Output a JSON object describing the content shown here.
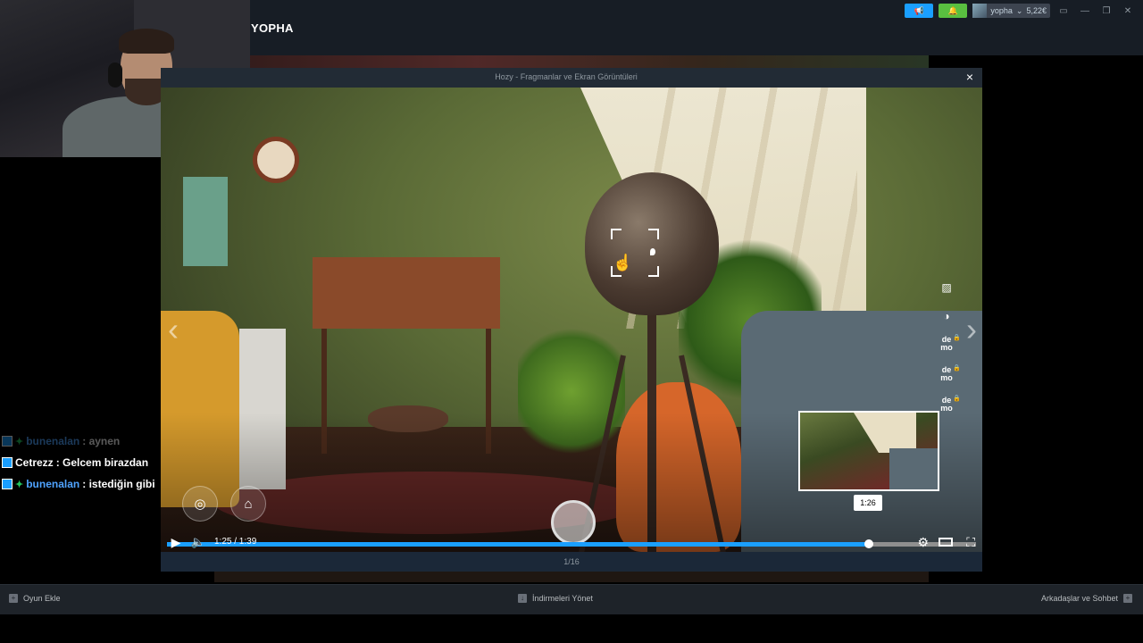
{
  "app": {
    "username_title": "YOPHA",
    "account": {
      "name": "yopha",
      "balance": "5,22€"
    }
  },
  "modal": {
    "title": "Hozy - Fragmanlar ve Ekran Görüntüleri",
    "close_icon": "×",
    "page_counter": "1/16"
  },
  "player": {
    "current_time": "1:25",
    "duration": "1:39",
    "time_display": "1:25 / 1:39",
    "hover_time": "1:26",
    "progress_fraction": 0.868,
    "demo_label": "de mo"
  },
  "chat": [
    {
      "user": "bunenalan",
      "message": ": aynen",
      "faded": true,
      "user_color": "#4fa3ff"
    },
    {
      "user": "Cetrezz",
      "message": ": Gelcem birazdan",
      "faded": false,
      "user_color": "#ffffff"
    },
    {
      "user": "bunenalan",
      "message": ": istediğin gibi",
      "faded": false,
      "user_color": "#4fa3ff"
    }
  ],
  "bottombar": {
    "add_game": "Oyun Ekle",
    "manage_downloads": "İndirmeleri Yönet",
    "friends_chat": "Arkadaşlar ve Sohbet"
  },
  "colors": {
    "accent": "#1a9fff",
    "notify": "#59bf40",
    "bg": "#171d25"
  },
  "icons": [
    "announce-icon",
    "bell-icon",
    "monitor-icon",
    "minimize-icon",
    "restore-icon",
    "close-icon",
    "play-icon",
    "volume-icon",
    "gear-icon",
    "theater-icon",
    "fullscreen-icon",
    "hide-ui-icon",
    "camera-icon",
    "filter-icon",
    "contrast-icon",
    "lock-icon",
    "chevron-left-icon",
    "chevron-right-icon",
    "hand-cursor-icon"
  ]
}
